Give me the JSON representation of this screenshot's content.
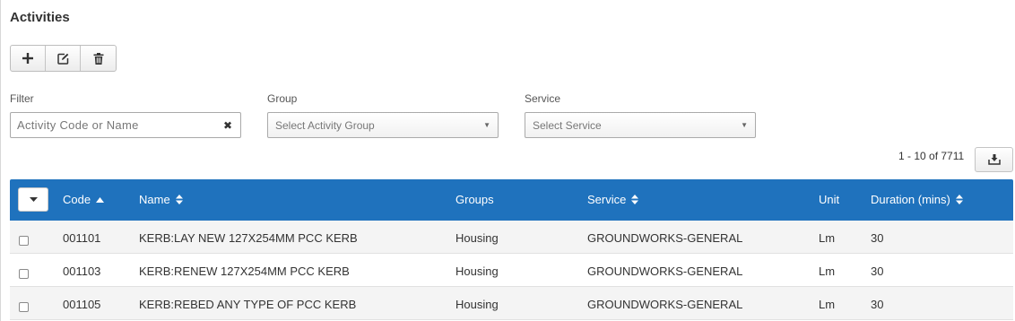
{
  "page": {
    "title": "Activities"
  },
  "toolbar": {
    "add_icon": "plus-icon",
    "edit_icon": "edit-icon",
    "delete_icon": "trash-icon"
  },
  "filters": {
    "filter": {
      "label": "Filter",
      "placeholder": "Activity Code or Name",
      "value": ""
    },
    "group": {
      "label": "Group",
      "placeholder": "Select Activity Group"
    },
    "service": {
      "label": "Service",
      "placeholder": "Select Service"
    }
  },
  "pager": {
    "text": "1 - 10 of 7711"
  },
  "table": {
    "columns": [
      {
        "label": "Code",
        "sort": "asc"
      },
      {
        "label": "Name",
        "sort": "both"
      },
      {
        "label": "Groups",
        "sort": "none"
      },
      {
        "label": "Service",
        "sort": "both"
      },
      {
        "label": "Unit",
        "sort": "none"
      },
      {
        "label": "Duration (mins)",
        "sort": "both"
      }
    ],
    "rows": [
      {
        "code": "001101",
        "name": "KERB:LAY NEW 127X254MM PCC KERB",
        "groups": "Housing",
        "service": "GROUNDWORKS-GENERAL",
        "unit": "Lm",
        "duration": "30"
      },
      {
        "code": "001103",
        "name": "KERB:RENEW 127X254MM PCC KERB",
        "groups": "Housing",
        "service": "GROUNDWORKS-GENERAL",
        "unit": "Lm",
        "duration": "30"
      },
      {
        "code": "001105",
        "name": "KERB:REBED ANY TYPE OF PCC KERB",
        "groups": "Housing",
        "service": "GROUNDWORKS-GENERAL",
        "unit": "Lm",
        "duration": "30"
      }
    ]
  },
  "colors": {
    "header_bg": "#1f72bd",
    "header_text": "#ffffff",
    "odd_row": "#f4f4f4"
  }
}
